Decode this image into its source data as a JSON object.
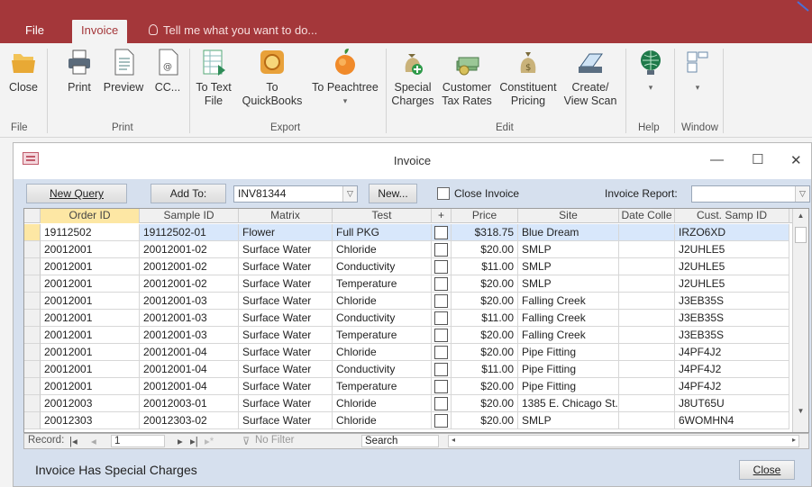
{
  "tabs": {
    "file": "File",
    "invoice": "Invoice",
    "tell_me": "Tell me what you want to do..."
  },
  "ribbon": {
    "buttons": {
      "close": "Close",
      "print": "Print",
      "preview": "Preview",
      "cc": "CC...",
      "to_text_file": [
        "To Text",
        "File"
      ],
      "to_quickbooks": [
        "To",
        "QuickBooks"
      ],
      "to_peachtree": "To Peachtree",
      "special_charges": [
        "Special",
        "Charges"
      ],
      "customer_tax_rates": [
        "Customer",
        "Tax Rates"
      ],
      "constituent_pricing": [
        "Constituent",
        "Pricing"
      ],
      "create_view_scan": [
        "Create/",
        "View Scan"
      ]
    },
    "groups": {
      "file": "File",
      "print": "Print",
      "export": "Export",
      "edit": "Edit",
      "help": "Help",
      "window": "Window"
    }
  },
  "form": {
    "title": "Invoice",
    "new_query": "New Query",
    "add_to": "Add To:",
    "invoice_number": "INV81344",
    "new_button": "New...",
    "close_invoice": "Close Invoice",
    "invoice_report": "Invoice Report:",
    "status_message": "Invoice Has Special Charges",
    "close_button": "Close"
  },
  "table": {
    "columns": [
      "Order ID",
      "Sample ID",
      "Matrix",
      "Test",
      "+",
      "Price",
      "Site",
      "Date Colle",
      "Cust. Samp ID"
    ],
    "rows": [
      [
        "19112502",
        "19112502-01",
        "Flower",
        "Full PKG",
        "",
        "$318.75",
        "Blue Dream",
        "",
        "IRZO6XD"
      ],
      [
        "20012001",
        "20012001-02",
        "Surface Water",
        "Chloride",
        "",
        "$20.00",
        "SMLP",
        "",
        "J2UHLE5"
      ],
      [
        "20012001",
        "20012001-02",
        "Surface Water",
        "Conductivity",
        "",
        "$11.00",
        "SMLP",
        "",
        "J2UHLE5"
      ],
      [
        "20012001",
        "20012001-02",
        "Surface Water",
        "Temperature",
        "",
        "$20.00",
        "SMLP",
        "",
        "J2UHLE5"
      ],
      [
        "20012001",
        "20012001-03",
        "Surface Water",
        "Chloride",
        "",
        "$20.00",
        "Falling Creek",
        "",
        "J3EB35S"
      ],
      [
        "20012001",
        "20012001-03",
        "Surface Water",
        "Conductivity",
        "",
        "$11.00",
        "Falling Creek",
        "",
        "J3EB35S"
      ],
      [
        "20012001",
        "20012001-03",
        "Surface Water",
        "Temperature",
        "",
        "$20.00",
        "Falling Creek",
        "",
        "J3EB35S"
      ],
      [
        "20012001",
        "20012001-04",
        "Surface Water",
        "Chloride",
        "",
        "$20.00",
        "Pipe Fitting",
        "",
        "J4PF4J2"
      ],
      [
        "20012001",
        "20012001-04",
        "Surface Water",
        "Conductivity",
        "",
        "$11.00",
        "Pipe Fitting",
        "",
        "J4PF4J2"
      ],
      [
        "20012001",
        "20012001-04",
        "Surface Water",
        "Temperature",
        "",
        "$20.00",
        "Pipe Fitting",
        "",
        "J4PF4J2"
      ],
      [
        "20012003",
        "20012003-01",
        "Surface Water",
        "Chloride",
        "",
        "$20.00",
        "1385 E. Chicago St.",
        "",
        "J8UT65U"
      ],
      [
        "20012303",
        "20012303-02",
        "Surface Water",
        "Chloride",
        "",
        "$20.00",
        "SMLP",
        "",
        "6WOMHN4"
      ]
    ]
  },
  "navigation": {
    "record_label": "Record:",
    "record_value": "1",
    "no_filter": "No Filter",
    "search": "Search"
  }
}
